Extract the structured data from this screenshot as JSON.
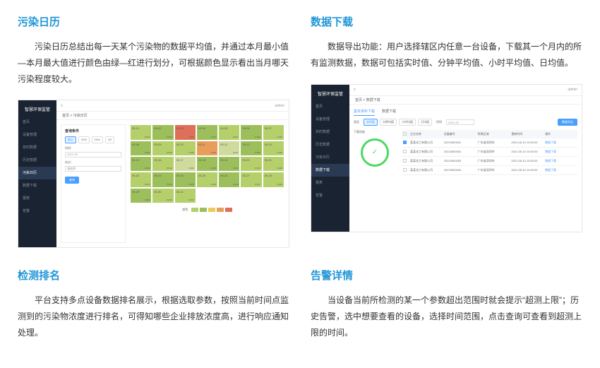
{
  "sections": [
    {
      "title": "污染日历",
      "text": "污染日历总结出每一天某个污染物的数据平均值，并通过本月最小值—本月最大值进行颜色由绿—红进行划分，可根据颜色显示看出当月哪天污染程度较大。"
    },
    {
      "title": "数据下载",
      "text": "数据导出功能：用户选择辖区内任意一台设备，下载其一个月内的所有监测数据，数据可包括实时值、分钟平均值、小时平均值、日均值。"
    },
    {
      "title": "检测排名",
      "text": "平台支持多点设备数据排名展示，根据选取参数，按照当前时间点监测到的污染物浓度进行排名，可得知哪些企业排放浓度高，进行响应通知处理。"
    },
    {
      "title": "告警详情",
      "text": "当设备当前所检测的某一个参数超出范围时就会提示“超测上限”；历史告警，选中想要查看的设备，选择时间范围，点击查询可查看到超测上限的时间。"
    }
  ],
  "calendar_ss": {
    "logo": "智慧环保监管",
    "sidebar": [
      "首页",
      "设备管理",
      "实时数据",
      "历史数据",
      "污染日历",
      "数据下载",
      "报表",
      "告警"
    ],
    "breadcrumb": "首页 > 污染日历",
    "user": "admin",
    "filter_title": "查询条件",
    "chips": [
      "烟尘",
      "SO2",
      "NOx",
      "O2"
    ],
    "label_time": "时间：",
    "time_value": "2021-05",
    "label_point": "站点：",
    "point_value": "请选择",
    "btn_query": "查询",
    "legend_label": "颜色",
    "calendar": [
      {
        "d": "05-01",
        "v": "0.016",
        "c": "c-g1"
      },
      {
        "d": "05-02",
        "v": "0.018",
        "c": "c-g2"
      },
      {
        "d": "05-03",
        "v": "0.042",
        "c": "c-r"
      },
      {
        "d": "05-04",
        "v": "0.021",
        "c": "c-g2"
      },
      {
        "d": "05-05",
        "v": "0.017",
        "c": "c-g1"
      },
      {
        "d": "05-06",
        "v": "0.019",
        "c": "c-g2"
      },
      {
        "d": "05-07",
        "v": "0.015",
        "c": "c-g1"
      },
      {
        "d": "05-08",
        "v": "0.020",
        "c": "c-g2"
      },
      {
        "d": "05-09",
        "v": "0.018",
        "c": "c-g1"
      },
      {
        "d": "05-10",
        "v": "0.016",
        "c": "c-g1"
      },
      {
        "d": "05-11",
        "v": "0.031",
        "c": "c-o"
      },
      {
        "d": "05-12",
        "v": "0.017",
        "c": "c-g3"
      },
      {
        "d": "05-13",
        "v": "0.022",
        "c": "c-g2"
      },
      {
        "d": "05-14",
        "v": "0.015",
        "c": "c-g1"
      },
      {
        "d": "05-15",
        "v": "0.018",
        "c": "c-g2"
      },
      {
        "d": "05-16",
        "v": "0.016",
        "c": "c-g1"
      },
      {
        "d": "05-17",
        "v": "0.024",
        "c": "c-g3"
      },
      {
        "d": "05-18",
        "v": "0.019",
        "c": "c-g2"
      },
      {
        "d": "05-19",
        "v": "0.021",
        "c": "c-g2"
      },
      {
        "d": "05-20",
        "v": "0.017",
        "c": "c-g1"
      },
      {
        "d": "05-21",
        "v": "0.016",
        "c": "c-g1"
      },
      {
        "d": "05-22",
        "v": "0.014",
        "c": "c-g1"
      },
      {
        "d": "05-23",
        "v": "0.018",
        "c": "c-g2"
      },
      {
        "d": "05-24",
        "v": "0.020",
        "c": "c-g2"
      },
      {
        "d": "05-25",
        "v": "0.016",
        "c": "c-g1"
      },
      {
        "d": "05-26",
        "v": "0.019",
        "c": "c-g2"
      },
      {
        "d": "05-27",
        "v": "0.017",
        "c": "c-g1"
      },
      {
        "d": "05-28",
        "v": "0.015",
        "c": "c-g1"
      },
      {
        "d": "05-29",
        "v": "0.018",
        "c": "c-g2"
      },
      {
        "d": "05-30",
        "v": "0.016",
        "c": "c-g1"
      },
      {
        "d": "05-31",
        "v": "0.017",
        "c": "c-g1"
      }
    ]
  },
  "download_ss": {
    "logo": "智慧环保监管",
    "sidebar": [
      "首页",
      "设备管理",
      "实时数据",
      "历史数据",
      "污染日历",
      "数据下载",
      "报表",
      "告警"
    ],
    "breadcrumb": "首页 > 数据下载",
    "user": "admin",
    "tabs": [
      "基本资料下载",
      "数据下载"
    ],
    "filter_label_type": "类型",
    "filter_label_time": "时间",
    "chips": [
      "实时值",
      "分钟均值",
      "小时均值",
      "日均值"
    ],
    "time_value": "2021-05",
    "section_label": "下载进度",
    "btn_export": "数据导出",
    "table_headers": [
      "",
      "企业名称",
      "设备编号",
      "所属区域",
      "更新时间",
      "操作"
    ],
    "rows": [
      {
        "name": "某某化工有限公司",
        "dev": "20210500001",
        "area": "广东省深圳市",
        "time": "2021-05-10 10:00:00",
        "op": "数据下载"
      },
      {
        "name": "某某化工有限公司",
        "dev": "20210500002",
        "area": "广东省深圳市",
        "time": "2021-05-10 10:00:00",
        "op": "数据下载"
      },
      {
        "name": "某某化工有限公司",
        "dev": "20210500003",
        "area": "广东省深圳市",
        "time": "2021-05-10 10:00:00",
        "op": "数据下载"
      },
      {
        "name": "某某化工有限公司",
        "dev": "20210500004",
        "area": "广东省深圳市",
        "time": "2021-05-10 10:00:00",
        "op": "数据下载"
      }
    ]
  }
}
